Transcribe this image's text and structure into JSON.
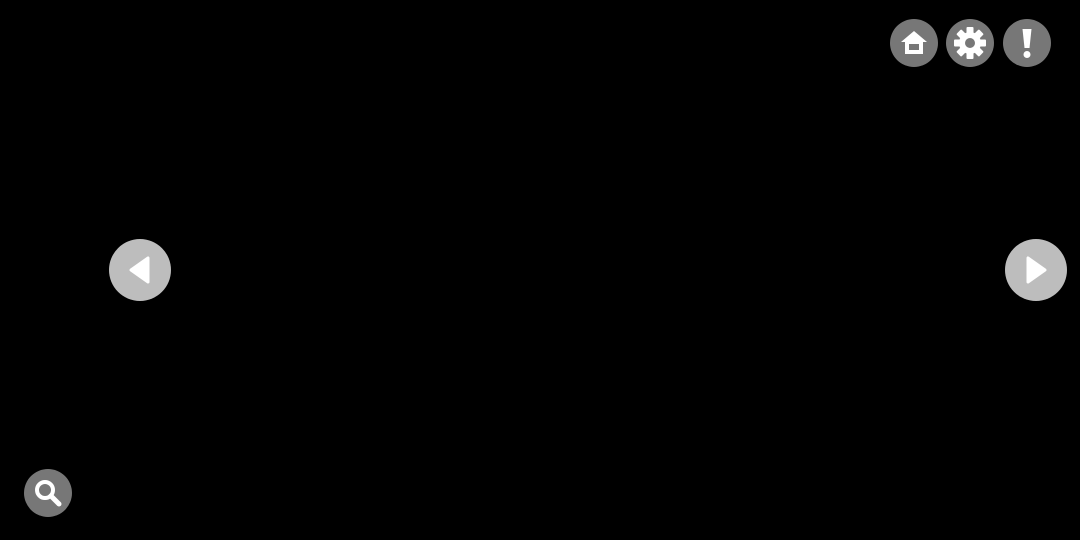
{
  "colors": {
    "background": "#000000",
    "top_button_fill": "#777777",
    "nav_button_fill": "#bdbdbd",
    "icon_fill": "#ffffff"
  },
  "controls": {
    "home": {
      "icon": "home-icon"
    },
    "settings": {
      "icon": "gear-icon"
    },
    "alert": {
      "icon": "exclamation-icon"
    },
    "previous": {
      "icon": "triangle-left-icon"
    },
    "next": {
      "icon": "triangle-right-icon"
    },
    "search": {
      "icon": "magnifier-icon"
    }
  }
}
